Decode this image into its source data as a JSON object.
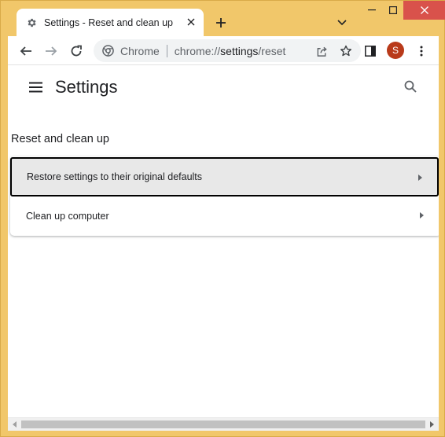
{
  "tab": {
    "title": "Settings - Reset and clean up",
    "icon": "gear-icon"
  },
  "toolbar": {
    "site_label": "Chrome",
    "url_prefix": "chrome://",
    "url_path": "settings",
    "url_suffix": "/reset",
    "avatar_letter": "S"
  },
  "header": {
    "title": "Settings"
  },
  "section": {
    "title": "Reset and clean up",
    "items": [
      {
        "label": "Restore settings to their original defaults"
      },
      {
        "label": "Clean up computer"
      }
    ]
  },
  "colors": {
    "frame": "#f1c76a",
    "close_button": "#d9524b",
    "avatar": "#b93a1a",
    "selected_row": "#e8e8e8"
  }
}
